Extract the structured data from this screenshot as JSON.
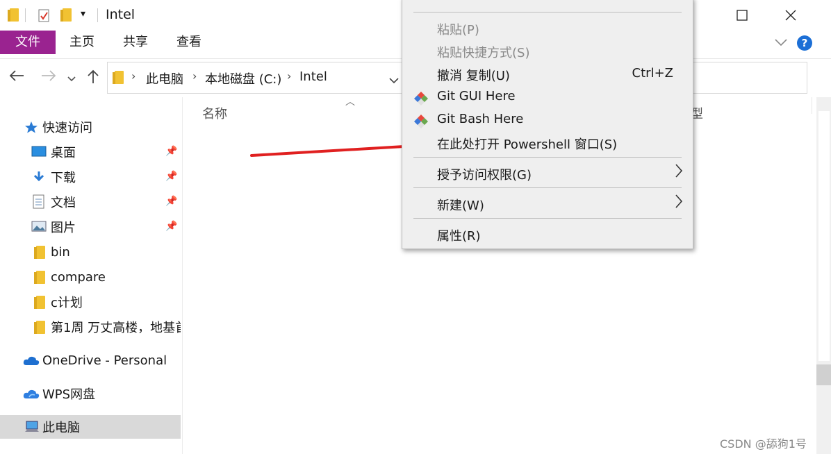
{
  "window": {
    "title": "Intel",
    "controls": {
      "minimize": "—",
      "maximize": "☐",
      "close": "✕"
    }
  },
  "ribbon": {
    "tabs": [
      "文件",
      "主页",
      "共享",
      "查看"
    ],
    "help": "?",
    "collapse": "﹀"
  },
  "address": {
    "crumbs": [
      "此电脑",
      "本地磁盘 (C:)",
      "Intel"
    ]
  },
  "sidebar": {
    "items": [
      {
        "label": "快速访问",
        "icon": "star-icon"
      },
      {
        "label": "桌面",
        "icon": "desktop-icon",
        "pinned": true
      },
      {
        "label": "下载",
        "icon": "download-icon",
        "pinned": true
      },
      {
        "label": "文档",
        "icon": "document-icon",
        "pinned": true
      },
      {
        "label": "图片",
        "icon": "picture-icon",
        "pinned": true
      },
      {
        "label": "bin",
        "icon": "folder-icon"
      },
      {
        "label": "compare",
        "icon": "folder-icon"
      },
      {
        "label": "c计划",
        "icon": "folder-icon"
      },
      {
        "label": "第1周 万丈高楼，地基首",
        "icon": "folder-icon"
      },
      {
        "label": "OneDrive - Personal",
        "icon": "cloud-icon"
      },
      {
        "label": "WPS网盘",
        "icon": "cloud-icon"
      },
      {
        "label": "此电脑",
        "icon": "computer-icon",
        "selected": true
      }
    ]
  },
  "columns": {
    "name": "名称",
    "type": "型"
  },
  "context_menu": {
    "items": [
      {
        "label": "粘贴(P)",
        "disabled": true
      },
      {
        "label": "粘贴快捷方式(S)",
        "disabled": true
      },
      {
        "label": "撤消 复制(U)",
        "shortcut": "Ctrl+Z"
      },
      {
        "label": "Git GUI Here",
        "icon": "git-gui-icon"
      },
      {
        "label": "Git Bash Here",
        "icon": "git-bash-icon"
      },
      {
        "label": "在此处打开 Powershell 窗口(S)"
      },
      {
        "label": "授予访问权限(G)",
        "submenu": true
      },
      {
        "label": "新建(W)",
        "submenu": true
      },
      {
        "label": "属性(R)"
      }
    ]
  },
  "colors": {
    "file_tab": "#9a2390",
    "arrow": "#e02020",
    "selected": "#d9d9d9"
  },
  "watermark": "CSDN @舔狗1号"
}
